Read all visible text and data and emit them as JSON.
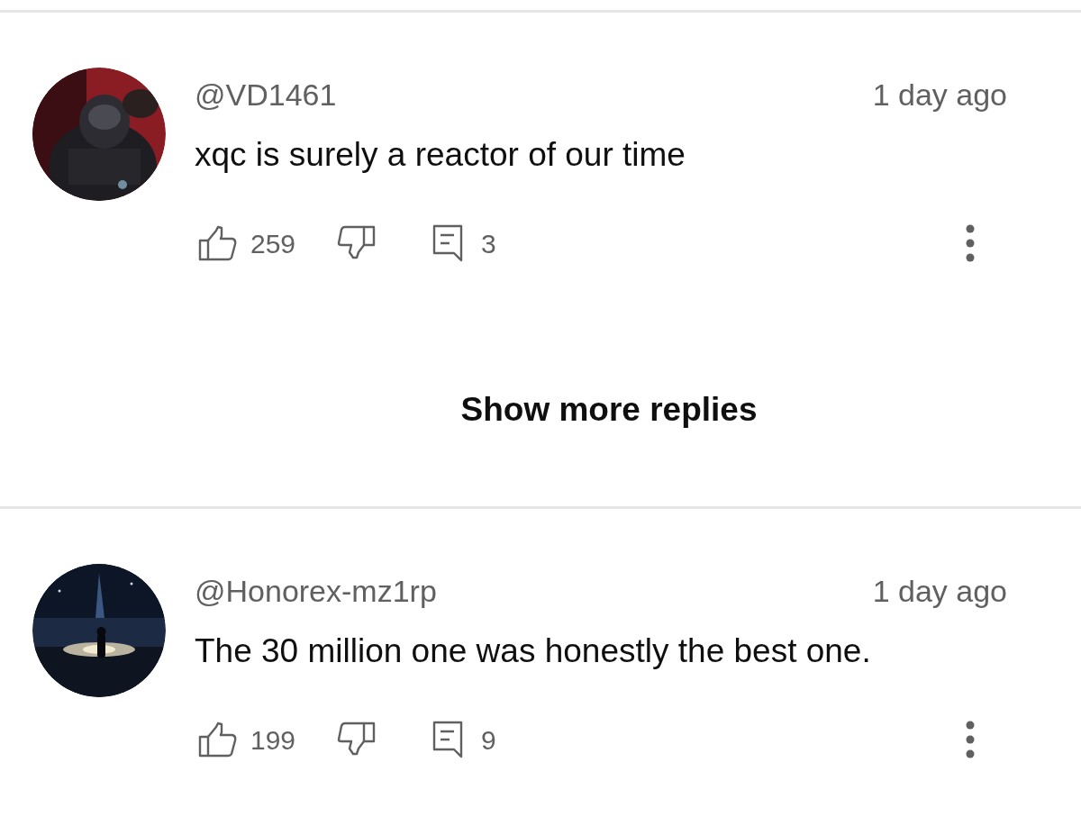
{
  "comments": [
    {
      "author": "@VD1461",
      "time": "1 day ago",
      "text": "xqc is surely a reactor of our time",
      "likes": "259",
      "replies": "3",
      "show_more_replies": {
        "label": "Show more replies"
      }
    },
    {
      "author": "@Honorex-mz1rp",
      "time": "1 day ago",
      "text": "The 30 million one was honestly the best one.",
      "likes": "199",
      "replies": "9"
    }
  ]
}
